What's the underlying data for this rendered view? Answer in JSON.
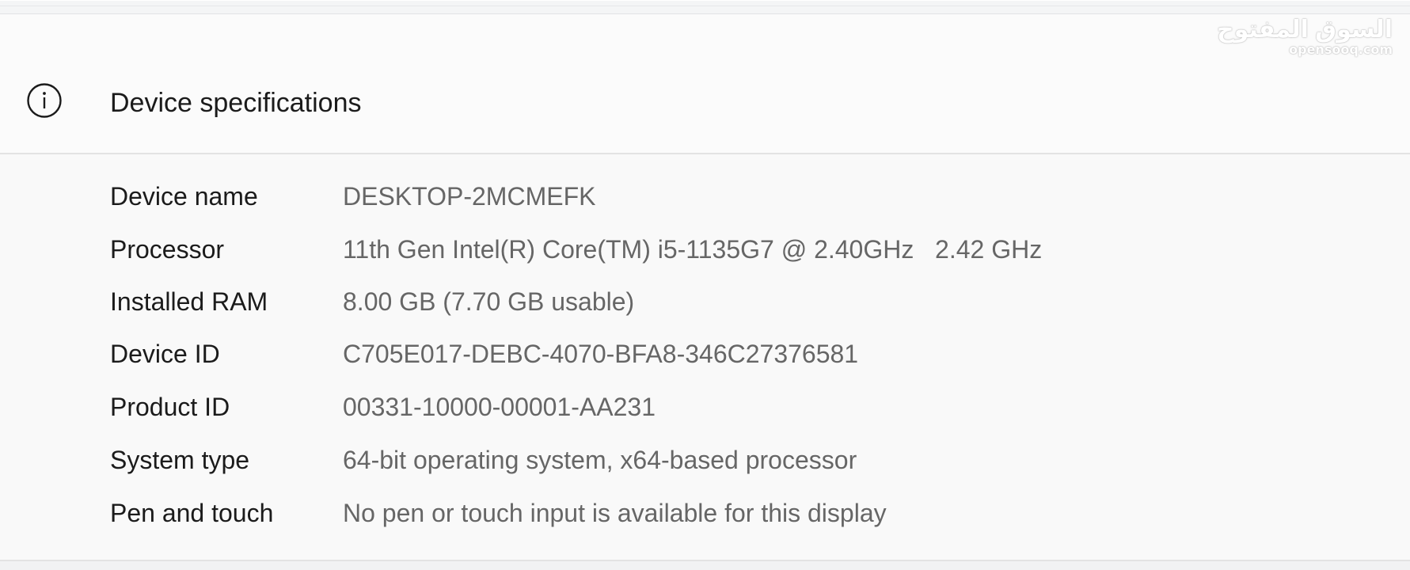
{
  "section": {
    "title": "Device specifications",
    "icon": "info-icon"
  },
  "specs": [
    {
      "label": "Device name",
      "value": "DESKTOP-2MCMEFK"
    },
    {
      "label": "Processor",
      "value": "11th Gen Intel(R) Core(TM) i5-1135G7 @ 2.40GHz   2.42 GHz"
    },
    {
      "label": "Installed RAM",
      "value": "8.00 GB (7.70 GB usable)"
    },
    {
      "label": "Device ID",
      "value": "C705E017-DEBC-4070-BFA8-346C27376581"
    },
    {
      "label": "Product ID",
      "value": "00331-10000-00001-AA231"
    },
    {
      "label": "System type",
      "value": "64-bit operating system, x64-based processor"
    },
    {
      "label": "Pen and touch",
      "value": "No pen or touch input is available for this display"
    }
  ],
  "watermark": {
    "arabic": "السوق المفتوح",
    "latin": "opensooq.com"
  }
}
